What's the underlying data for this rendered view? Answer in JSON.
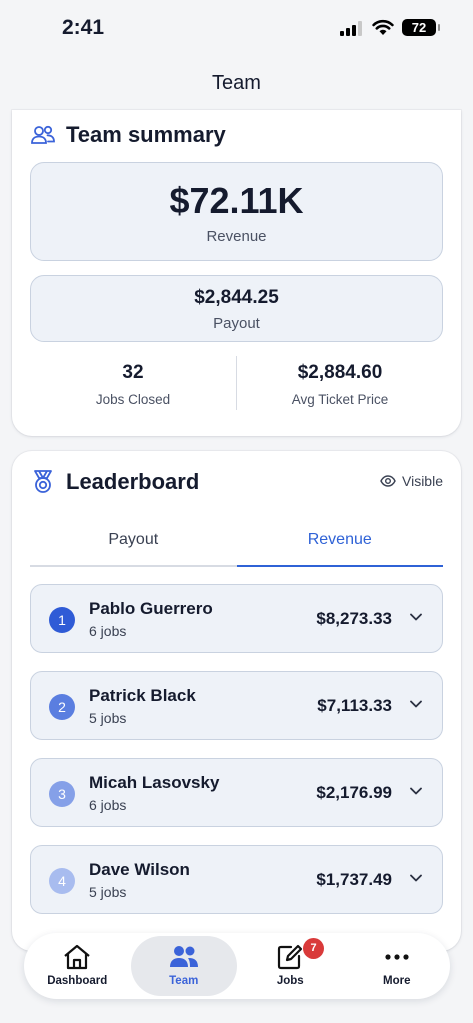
{
  "status_bar": {
    "time": "2:41",
    "battery": "72"
  },
  "nav": {
    "title": "Team"
  },
  "summary": {
    "title": "Team summary",
    "icon": "team-icon",
    "revenue_value": "$72.11K",
    "revenue_label": "Revenue",
    "payout_value": "$2,844.25",
    "payout_label": "Payout",
    "jobs_closed_value": "32",
    "jobs_closed_label": "Jobs Closed",
    "avg_ticket_value": "$2,884.60",
    "avg_ticket_label": "Avg Ticket Price"
  },
  "leaderboard": {
    "title": "Leaderboard",
    "icon": "medal-icon",
    "visibility_label": "Visible",
    "tabs": [
      {
        "label": "Payout",
        "active": false
      },
      {
        "label": "Revenue",
        "active": true
      }
    ],
    "rows": [
      {
        "rank": "1",
        "name": "Pablo Guerrero",
        "jobs": "6 jobs",
        "amount": "$8,273.33",
        "rank_color": "#2f5bd6"
      },
      {
        "rank": "2",
        "name": "Patrick Black",
        "jobs": "5 jobs",
        "amount": "$7,113.33",
        "rank_color": "#5a7ee0"
      },
      {
        "rank": "3",
        "name": "Micah Lasovsky",
        "jobs": "6 jobs",
        "amount": "$2,176.99",
        "rank_color": "#85a0e8"
      },
      {
        "rank": "4",
        "name": "Dave Wilson",
        "jobs": "5 jobs",
        "amount": "$1,737.49",
        "rank_color": "#a8bcef"
      }
    ]
  },
  "tabbar": {
    "items": [
      {
        "label": "Dashboard",
        "icon": "home-icon"
      },
      {
        "label": "Team",
        "icon": "team-icon",
        "active": true
      },
      {
        "label": "Jobs",
        "icon": "edit-icon",
        "badge": "7"
      },
      {
        "label": "More",
        "icon": "more-icon"
      }
    ]
  },
  "colors": {
    "accent": "#2f62d6",
    "badge": "#d93a3a",
    "metric_bg": "#eef2f8"
  }
}
